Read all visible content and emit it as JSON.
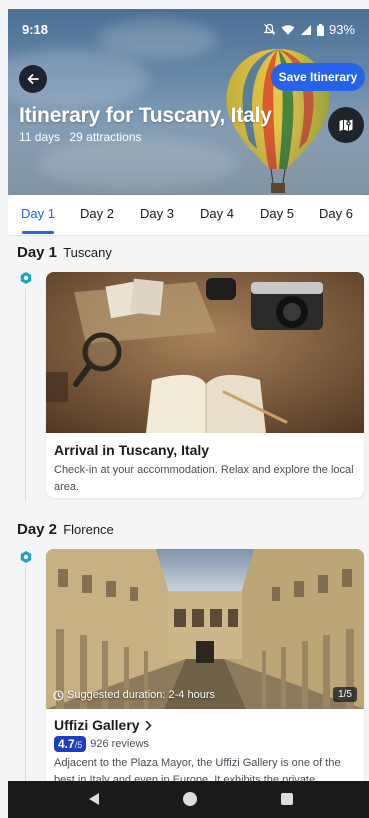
{
  "status_bar": {
    "time": "9:18",
    "battery": "93%"
  },
  "header": {
    "save_label": "Save Itinerary",
    "title": "Itinerary for Tuscany, Italy",
    "days": "11 days",
    "attractions": "29 attractions",
    "back_icon": "arrow-left-icon",
    "map_icon": "map-icon"
  },
  "tabs": [
    {
      "label": "Day 1",
      "active": true
    },
    {
      "label": "Day 2",
      "active": false
    },
    {
      "label": "Day 3",
      "active": false
    },
    {
      "label": "Day 4",
      "active": false
    },
    {
      "label": "Day 5",
      "active": false
    },
    {
      "label": "Day 6",
      "active": false
    }
  ],
  "itinerary": [
    {
      "day": "Day 1",
      "place": "Tuscany",
      "card": {
        "title": "Arrival in Tuscany, Italy",
        "description": "Check-in at your accommodation. Relax and explore the local area."
      }
    },
    {
      "day": "Day 2",
      "place": "Florence",
      "card": {
        "duration": "Suggested duration: 2-4 hours",
        "image_counter": "1/5",
        "title": "Uffizi Gallery",
        "rating": "4.7",
        "rating_max": "/5",
        "reviews": "926 reviews",
        "description": "Adjacent to the Plaza Mayor, the Uffizi Gallery is one of the best in Italy and even in Europe. It exhibits the private"
      }
    }
  ],
  "colors": {
    "accent": "#2563eb",
    "rating": "#1d3fbf",
    "timeline": "#1aa3c4"
  }
}
